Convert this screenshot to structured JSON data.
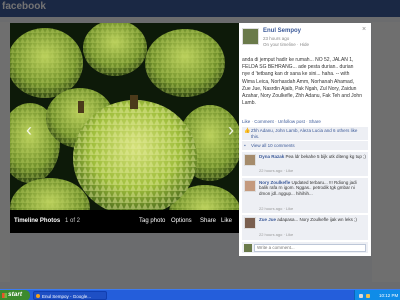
{
  "browser": {
    "logo_text": "facebook"
  },
  "photo_viewer": {
    "album_title": "Timeline Photos",
    "counter": "1 of 2",
    "actions": [
      "Tag photo",
      "Options",
      "Share",
      "Like"
    ],
    "prev_glyph": "‹",
    "next_glyph": "›",
    "close_glyph": "×"
  },
  "post": {
    "author": "Enul Sempoy",
    "time": "23 hours ago",
    "location": "On your timeline · Hide",
    "caption": "anda di jemput hadir ke rumah... NO 52, JALAN 1, FELDA SG BEHRANG... ade pesta durian.. durian nye d 'tetbang kan dr sana ke sini... haha. -- with Wima Leica, Norhasdah Amm, Norhanah Ahamad, Zue Jue, Nasrdin Ajaib, Pak Ngah, Zul Nory, Zaidun Azahar, Nory Zoulkefle, Zhh Adanu, Fak Teh and John Lamb.",
    "actions": [
      "Like",
      "Comment",
      "Unfollow post",
      "Share"
    ],
    "likes_text": "Zhh Adanu, John Lamb, Aleza Lucia and 6 others like this.",
    "view_all": "View all 10 comments",
    "comments": [
      {
        "name": "Dyna Razak",
        "text": "Pea ldr bekahe 5 bijk utk diteng kg tup ;)",
        "meta": "22 hours ago · Like"
      },
      {
        "name": "Nory Zoulkefle",
        "text": "Updated terbaru... !!! Rdiong jadi balik rafa rn igom. Nggas.. petrodik tgk gmbar ni dmon jdl..nggup... hihihih...",
        "meta": "22 hours ago · Like"
      },
      {
        "name": "Zue Jue",
        "text": "adapasa... Nory Zoulkefle ijak wn leks ;)",
        "meta": "22 hours ago · Like"
      }
    ],
    "write_placeholder": "Write a comment..."
  },
  "taskbar": {
    "start_label": "start",
    "window_label": "Enul Sempoy - Google...",
    "clock": "10:12 PM"
  },
  "colors": {
    "facebook_blue": "#3b5998",
    "taskbar_blue": "#245edb",
    "start_green": "#3c8a2e",
    "durian_green": "#9fbe3c"
  }
}
